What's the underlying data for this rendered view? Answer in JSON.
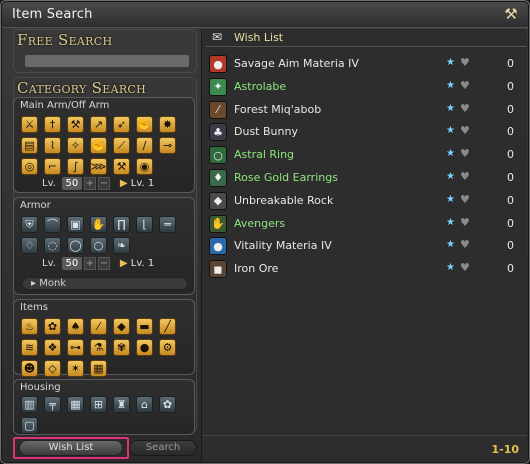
{
  "window": {
    "title": "Item Search",
    "title_icon": "close-x-icon"
  },
  "free_search": {
    "title": "Free Search",
    "value": ""
  },
  "category_search": {
    "title": "Category Search",
    "main_arm": {
      "label": "Main Arm/Off Arm",
      "icons": [
        "sword-icon",
        "dagger-icon",
        "axe-icon",
        "lance-icon",
        "bow-icon",
        "knuckle-icon",
        "claw-icon",
        "book-icon",
        "staff-icon",
        "wand-icon",
        "fist-icon",
        "glaive-icon",
        "katana-icon",
        "gun-icon",
        "chakram-icon",
        "rapier-icon",
        "brush-icon",
        "saw-icon",
        "hammer-icon",
        "frypan-icon"
      ],
      "level_label": "Lv.",
      "level_value": "50",
      "level_target": "Lv. 1"
    },
    "armor": {
      "label": "Armor",
      "icons": [
        "shield-icon",
        "helmet-icon",
        "chest-icon",
        "gloves-icon",
        "legs-icon",
        "boots-icon",
        "belt-icon",
        "earring-icon",
        "necklace-icon",
        "bracelet-icon",
        "ring-icon",
        "feather-icon"
      ],
      "level_label": "Lv.",
      "level_value": "50",
      "level_target": "Lv. 1",
      "job": "Monk"
    },
    "items": {
      "label": "Items",
      "icons": [
        "potion-icon",
        "food-icon",
        "meal-icon",
        "material-icon",
        "stone-icon",
        "metal-icon",
        "lumber-icon",
        "cloth-icon",
        "leather-icon",
        "bone-icon",
        "reagent-icon",
        "ingredient-icon",
        "dye-icon",
        "part-icon",
        "minion-icon",
        "crystal-icon",
        "catalyst-icon",
        "misc-icon"
      ]
    },
    "housing": {
      "label": "Housing",
      "icons": [
        "furniture-icon",
        "table-icon",
        "wall-icon",
        "window-icon",
        "tabletop-icon",
        "outdoor-icon",
        "garden-icon",
        "painting-icon"
      ]
    }
  },
  "buttons": {
    "wish_list": "Wish List",
    "search": "Search"
  },
  "wish_list": {
    "header": "Wish List",
    "items": [
      {
        "name": "Savage Aim Materia IV",
        "count": "0",
        "green": false,
        "icon": "materia-icon",
        "color": "#b23a2a",
        "glyph": "●"
      },
      {
        "name": "Astrolabe",
        "count": "0",
        "green": true,
        "icon": "astrolabe-icon",
        "color": "#3c8a4e",
        "glyph": "✦"
      },
      {
        "name": "Forest Miq'abob",
        "count": "0",
        "green": false,
        "icon": "kebab-icon",
        "color": "#6a4a2a",
        "glyph": "⁄"
      },
      {
        "name": "Dust Bunny",
        "count": "0",
        "green": false,
        "icon": "bunny-icon",
        "color": "#3a3a4a",
        "glyph": "♣"
      },
      {
        "name": "Astral Ring",
        "count": "0",
        "green": true,
        "icon": "ring-icon",
        "color": "#2f6a3a",
        "glyph": "○"
      },
      {
        "name": "Rose Gold Earrings",
        "count": "0",
        "green": true,
        "icon": "earring-icon",
        "color": "#3a6a4a",
        "glyph": "♦"
      },
      {
        "name": "Unbreakable Rock",
        "count": "0",
        "green": false,
        "icon": "rock-icon",
        "color": "#4a4a4a",
        "glyph": "◆"
      },
      {
        "name": "Avengers",
        "count": "0",
        "green": true,
        "icon": "avengers-icon",
        "color": "#3a5a30",
        "glyph": "✋"
      },
      {
        "name": "Vitality Materia IV",
        "count": "0",
        "green": false,
        "icon": "materia-icon",
        "color": "#2a6aa8",
        "glyph": "●"
      },
      {
        "name": "Iron Ore",
        "count": "0",
        "green": false,
        "icon": "ore-icon",
        "color": "#5a4636",
        "glyph": "◼"
      }
    ],
    "page_range": "1-10"
  },
  "colors": {
    "accent_gold": "#e8c050",
    "green_item": "#8ee67e",
    "highlight": "#e0307a"
  }
}
